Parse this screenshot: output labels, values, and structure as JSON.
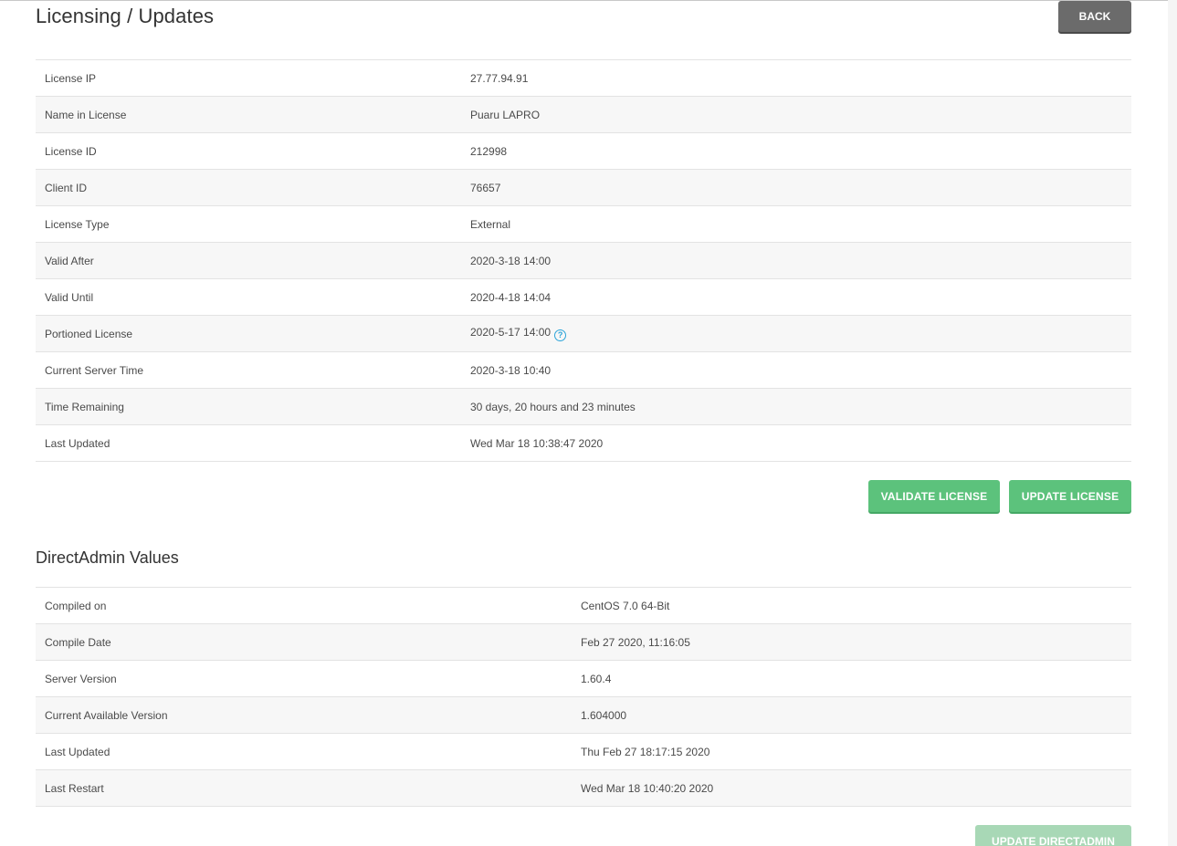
{
  "page": {
    "title": "Licensing / Updates",
    "back_label": "BACK"
  },
  "license": {
    "rows": [
      {
        "label": "License IP",
        "value": "27.77.94.91"
      },
      {
        "label": "Name in License",
        "value": "Puaru LAPRO"
      },
      {
        "label": "License ID",
        "value": "212998"
      },
      {
        "label": "Client ID",
        "value": "76657"
      },
      {
        "label": "License Type",
        "value": "External"
      },
      {
        "label": "Valid After",
        "value": "2020-3-18 14:00"
      },
      {
        "label": "Valid Until",
        "value": "2020-4-18 14:04"
      },
      {
        "label": "Portioned License",
        "value": "2020-5-17 14:00"
      },
      {
        "label": "Current Server Time",
        "value": "2020-3-18 10:40"
      },
      {
        "label": "Time Remaining",
        "value": "30 days, 20 hours and 23 minutes"
      },
      {
        "label": "Last Updated",
        "value": "Wed Mar 18 10:38:47 2020"
      }
    ],
    "validate_label": "VALIDATE LICENSE",
    "update_label": "UPDATE LICENSE",
    "help_icon": "?"
  },
  "directadmin": {
    "title": "DirectAdmin Values",
    "rows": [
      {
        "label": "Compiled on",
        "value": "CentOS 7.0 64-Bit"
      },
      {
        "label": "Compile Date",
        "value": "Feb 27 2020, 11:16:05"
      },
      {
        "label": "Server Version",
        "value": "1.60.4"
      },
      {
        "label": "Current Available Version",
        "value": "1.604000"
      },
      {
        "label": "Last Updated",
        "value": "Thu Feb 27 18:17:15 2020"
      },
      {
        "label": "Last Restart",
        "value": "Wed Mar 18 10:40:20 2020"
      }
    ],
    "update_label": "UPDATE DIRECTADMIN"
  },
  "colors": {
    "primary_green": "#5cc27c",
    "back_gray": "#6b6b6b",
    "help_blue": "#2ba4d9"
  }
}
